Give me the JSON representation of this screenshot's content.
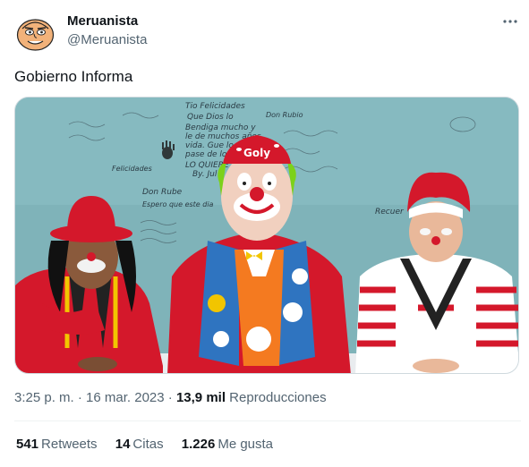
{
  "user": {
    "display_name": "Meruanista",
    "handle": "@Meruanista"
  },
  "tweet": {
    "text": "Gobierno Informa",
    "time": "3:25 p. m.",
    "separator": "·",
    "date": "16 mar. 2023",
    "views_count": "13,9 mil",
    "views_label": "Reproducciones"
  },
  "stats": {
    "retweets": {
      "count": "541",
      "label": "Retweets"
    },
    "quotes": {
      "count": "14",
      "label": "Citas"
    },
    "likes": {
      "count": "1.226",
      "label": "Me gusta"
    }
  },
  "media": {
    "hat_text": "Goly",
    "wall_text": [
      "Tio Felicidades",
      "Que Dios lo",
      "Bendiga mucho y",
      "le de muchos años",
      "vida. Gue lo",
      "pase de lo mejor",
      "LO QUIERE",
      "By. Jul",
      "Don Rube",
      "Espero que este dia",
      "Felicidades",
      "Recuer",
      "Don Rubio"
    ]
  },
  "colors": {
    "text_primary": "#0f1419",
    "text_secondary": "#536471",
    "divider": "#eff3f4",
    "wall": "#7fb3b9",
    "clown_red": "#d4182b"
  },
  "icons": {
    "avatar": "cartoon-face-avatar",
    "more": "more-horizontal-icon"
  }
}
